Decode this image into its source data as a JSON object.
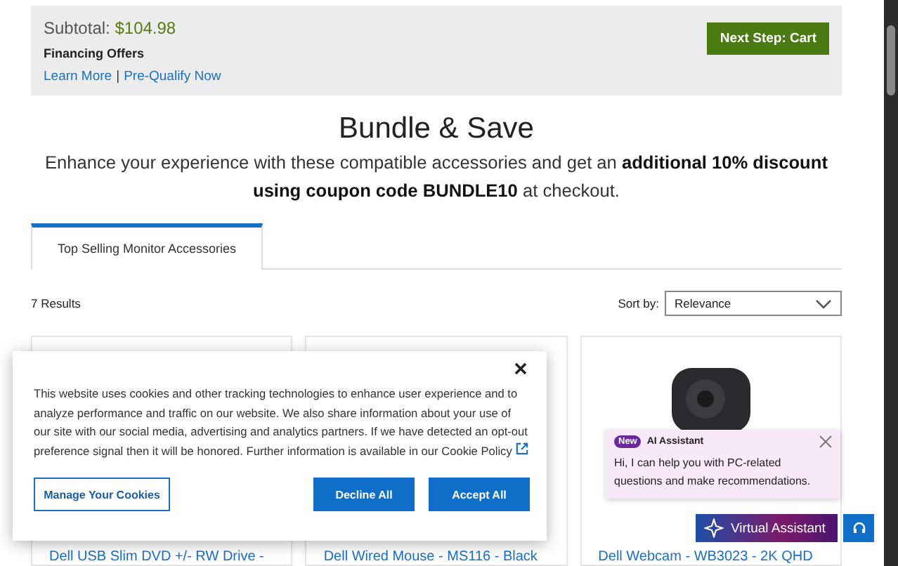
{
  "summary": {
    "subtotal_label": "Subtotal:",
    "subtotal": "$104.98",
    "financing": "Financing Offers",
    "links": [
      "Learn More",
      "Pre-Qualify Now"
    ],
    "separator": "|",
    "next_button": "Next Step: Cart"
  },
  "heading": "Bundle & Save",
  "subtitle": "Enhance your experience with these compatible accessories and get an **additional 10% discount using coupon code BUNDLE10** at checkout.",
  "tabs": [
    {
      "label": "Top Selling Monitor Accessories",
      "selected": true
    }
  ],
  "results": "7 Results",
  "sort": {
    "label": "Sort by:",
    "value": "Relevance"
  },
  "products": [
    {
      "title": "Dell USB Slim DVD +/- RW Drive -",
      "kind": "blank"
    },
    {
      "title": "Dell Wired Mouse - MS116 - Black",
      "kind": "blank"
    },
    {
      "title": "Dell Webcam - WB3023 - 2K QHD",
      "kind": "webcam"
    }
  ],
  "cookie_banner": {
    "text": "This website uses cookies and other tracking technologies to enhance user experience and to analyze performance and traffic on our website. We also share information about your use of our site with our social media, advertising and analytics partners. If we have detected an opt-out preference signal then it will be honored. Further information is available in our",
    "link": "Cookie Policy",
    "buttons": [
      {
        "label": "Manage Your Cookies",
        "kind": "outline"
      },
      {
        "label": "Decline All",
        "kind": "primary"
      },
      {
        "label": "Accept All",
        "kind": "primary"
      }
    ]
  },
  "assistant_popup": {
    "badge": "New",
    "title": "AI Assistant",
    "message": "Hi, I can help you with PC-related questions and make recommendations."
  },
  "assistant_button": "Virtual Assistant"
}
